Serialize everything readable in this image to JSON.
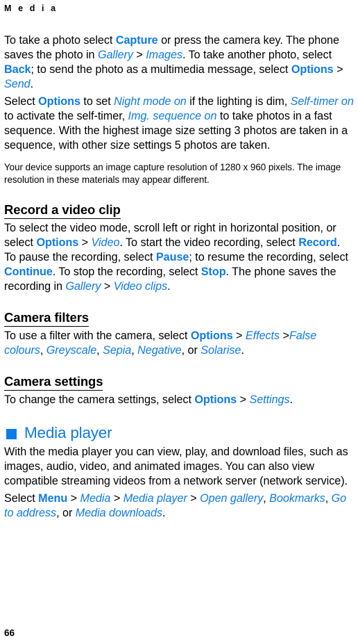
{
  "document": {
    "running_header": "M e d i a",
    "page_number": "66",
    "accent_color": "#0d7be8",
    "text_color": "#000000",
    "background_color": "#ffffff"
  },
  "camera_section": {
    "para1": {
      "s1": "To take a photo select ",
      "b1": "Capture",
      "s2": " or press the camera key. The phone saves the photo in ",
      "i1": "Gallery",
      "sep1": " > ",
      "i2": "Images",
      "s3": ". To take another photo, select ",
      "b2": "Back",
      "s4": "; to send the photo as a multimedia message, select ",
      "b3": "Options",
      "sep2": " > ",
      "i3": "Send",
      "s5": "."
    },
    "para2": {
      "s1": "Select ",
      "b1": "Options",
      "s2": " to set ",
      "i1": "Night mode on",
      "s3": " if the lighting is dim, ",
      "i2": "Self-timer on",
      "s4": " to activate the self-timer, ",
      "i3": "Img. sequence on",
      "s5": " to take photos in a fast sequence. With the highest image size setting 3 photos are taken in a sequence, with other size settings 5 photos are taken."
    },
    "note": "Your device supports an image capture resolution of 1280 x 960 pixels. The image resolution in these materials may appear different."
  },
  "video_section": {
    "heading": "Record a video clip",
    "para": {
      "s1": "To select the video mode, scroll left or right in horizontal position, or select ",
      "b1": "Options",
      "sep1": " > ",
      "i1": "Video",
      "s2": ". To start the video recording, select ",
      "b2": "Record",
      "s3": ". To pause the recording, select ",
      "b3": "Pause",
      "s4": "; to resume the recording, select ",
      "b4": "Continue",
      "s5": ". To stop the recording, select ",
      "b5": "Stop",
      "s6": ". The phone saves the recording in ",
      "i2": "Gallery",
      "sep2": " > ",
      "i3": "Video clips",
      "s7": "."
    }
  },
  "filters_section": {
    "heading": "Camera filters",
    "para": {
      "s1": "To use a filter with the camera, select ",
      "b1": "Options",
      "sep1": " > ",
      "i1": "Effects",
      "sep2": " >",
      "i2": "False colours",
      "s2": ", ",
      "i3": "Greyscale",
      "s3": ", ",
      "i4": "Sepia",
      "s4": ", ",
      "i5": "Negative",
      "s5": ", or ",
      "i6": "Solarise",
      "s6": "."
    }
  },
  "settings_section": {
    "heading": "Camera settings",
    "para": {
      "s1": "To change the camera settings, select ",
      "b1": "Options",
      "sep1": " > ",
      "i1": "Settings",
      "s2": "."
    }
  },
  "media_player_section": {
    "heading": "Media player",
    "bullet_icon": "filled-square-icon",
    "para1": "With the media player you can view, play, and download files, such as images, audio, video, and animated images. You can also view compatible streaming videos from a network server (network service).",
    "para2": {
      "s1": "Select ",
      "b1": "Menu",
      "sep1": " > ",
      "i1": "Media",
      "sep2": " > ",
      "i2": "Media player",
      "sep3": " > ",
      "i3": "Open gallery",
      "s2": ", ",
      "i4": "Bookmarks",
      "s3": ", ",
      "i5": "Go to address",
      "s4": ", or ",
      "i6": "Media downloads",
      "s5": "."
    }
  }
}
